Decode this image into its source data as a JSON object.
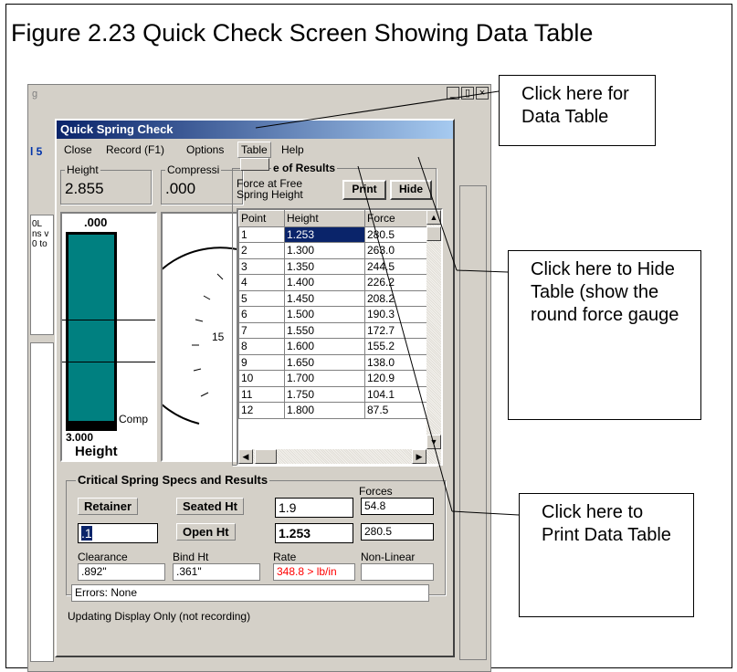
{
  "figure_title": "Figure 2.23  Quick Check Screen Showing Data Table",
  "dialog": {
    "title": "Quick Spring Check",
    "menu": [
      "Close",
      "Record (F1)",
      "Options",
      "Table",
      "Help"
    ],
    "height_label": "Height",
    "height_value": "2.855",
    "compress_label": "Compressi",
    "compress_value": ".000",
    "table_title": "e of Results",
    "force_label": "Force at Free Spring Height",
    "print_label": "Print",
    "hide_label": "Hide",
    "bar_top": ".000",
    "bar_bottom": "3.000",
    "bar_label": "Height",
    "comp_label": "Comp",
    "gauge_tick": "15",
    "status": "Updating Display Only (not recording)"
  },
  "table": {
    "headers": [
      "Point",
      "Height",
      "Force"
    ],
    "rows": [
      [
        "1",
        "1.253",
        "280.5"
      ],
      [
        "2",
        "1.300",
        "263.0"
      ],
      [
        "3",
        "1.350",
        "244.5"
      ],
      [
        "4",
        "1.400",
        "226.2"
      ],
      [
        "5",
        "1.450",
        "208.2"
      ],
      [
        "6",
        "1.500",
        "190.3"
      ],
      [
        "7",
        "1.550",
        "172.7"
      ],
      [
        "8",
        "1.600",
        "155.2"
      ],
      [
        "9",
        "1.650",
        "138.0"
      ],
      [
        "10",
        "1.700",
        "120.9"
      ],
      [
        "11",
        "1.750",
        "104.1"
      ],
      [
        "12",
        "1.800",
        "87.5"
      ]
    ]
  },
  "specs": {
    "group_label": "Critical Spring Specs and Results",
    "forces_label": "Forces",
    "retainer_label": "Retainer",
    "retainer_value": ".1",
    "seated_label": "Seated Ht",
    "seated_value": "1.9",
    "seated_force": "54.8",
    "open_label": "Open Ht",
    "open_value": "1.253",
    "open_force": "280.5",
    "clearance_label": "Clearance",
    "clearance_value": ".892\"",
    "bind_label": "Bind Ht",
    "bind_value": ".361\"",
    "rate_label": "Rate",
    "rate_value": "348.8 > lb/in",
    "nonlinear_label": "Non-Linear",
    "nonlinear_value": "",
    "errors_value": "Errors: None"
  },
  "background": {
    "left_text": [
      "0L",
      "ns v",
      "0 to"
    ],
    "side_marks": [
      "g",
      "l 5"
    ]
  },
  "callouts": {
    "data_table": "Click here for Data Table",
    "hide_table": "Click here to Hide Table (show the round force gauge",
    "print_table": "Click here to Print Data Table"
  },
  "colors": {
    "bar_fill": "#008080",
    "title_bar": "#0a246a",
    "rate_text": "#ff0000"
  }
}
